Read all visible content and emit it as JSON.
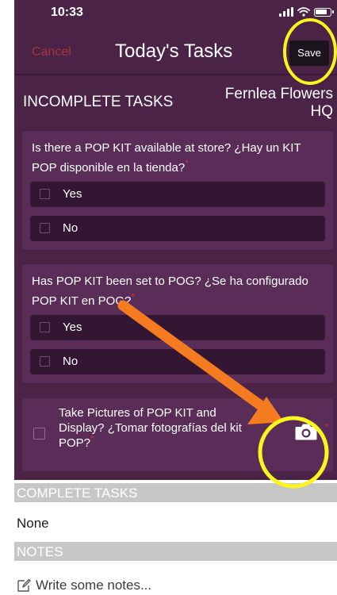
{
  "status_bar": {
    "time": "10:33"
  },
  "nav": {
    "cancel_label": "Cancel",
    "title": "Today's Tasks",
    "save_label": "Save"
  },
  "incomplete": {
    "heading": "INCOMPLETE TASKS",
    "store_line1": "Fernlea Flowers",
    "store_line2": "HQ",
    "tasks": [
      {
        "question": "Is there a POP KIT available at store?  ¿Hay un KIT POP disponible en la tienda?",
        "options": [
          "Yes",
          "No"
        ]
      },
      {
        "question": "Has POP KIT been set to POG?   ¿Se ha configurado POP KIT en POG?",
        "options": [
          "Yes",
          "No"
        ]
      },
      {
        "question": "Take Pictures of POP KIT and Display?   ¿Tomar fotografías del kit POP?",
        "action_icon": "camera-icon"
      }
    ]
  },
  "complete": {
    "heading": "COMPLETE TASKS",
    "value": "None"
  },
  "notes": {
    "heading": "NOTES",
    "placeholder": "Write some notes..."
  },
  "annotations": {
    "highlight_color": "#fbf51d",
    "arrow_color": "#f47b20"
  },
  "colors": {
    "header_background": "#4a2347",
    "card_background": "#5a2c58",
    "option_background": "#331631",
    "cancel_text": "#a8323e",
    "required_marker": "#d82a3c",
    "section_band": "#c7c7c7"
  }
}
